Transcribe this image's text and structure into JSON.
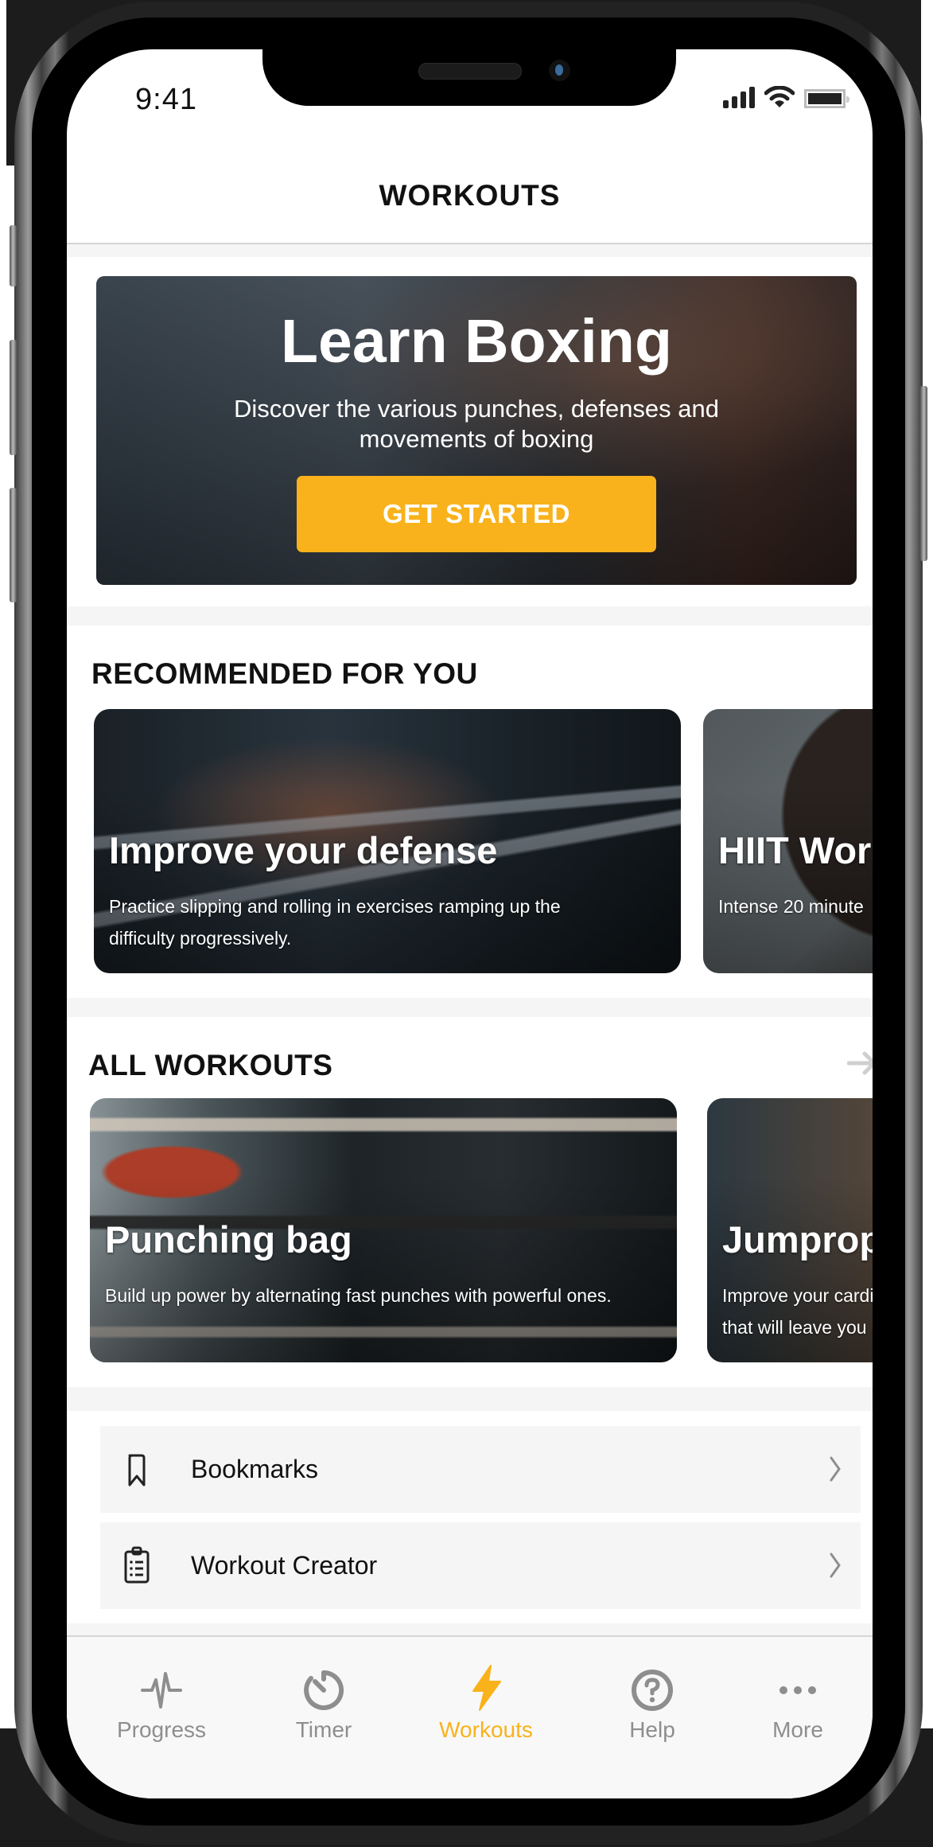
{
  "status_bar": {
    "time": "9:41",
    "icons": [
      "cellular-signal-icon",
      "wifi-icon",
      "battery-icon"
    ]
  },
  "header": {
    "title": "WORKOUTS"
  },
  "hero": {
    "title": "Learn Boxing",
    "subtitle": "Discover the various punches, defenses and movements of boxing",
    "button_label": "GET STARTED",
    "button_color": "#f9b21b"
  },
  "recommended": {
    "title": "RECOMMENDED FOR YOU",
    "cards": [
      {
        "title": "Improve your defense",
        "description": "Practice slipping and rolling in exercises ramping up the difficulty progressively."
      },
      {
        "title": "HIIT Wor",
        "description": "Intense 20 minute"
      }
    ]
  },
  "all_workouts": {
    "title": "ALL WORKOUTS",
    "see_all_icon": "arrow-right-icon",
    "cards": [
      {
        "title": "Punching bag",
        "description": "Build up power by alternating fast punches with powerful ones."
      },
      {
        "title": "Jumprop",
        "description": "Improve your cardi that will leave you"
      }
    ]
  },
  "links": [
    {
      "label": "Bookmarks",
      "icon": "bookmark-icon"
    },
    {
      "label": "Workout Creator",
      "icon": "clipboard-list-icon"
    }
  ],
  "tabbar": {
    "active_color": "#f9b21b",
    "inactive_color": "#8e8e8e",
    "tabs": [
      {
        "label": "Progress",
        "icon": "heartbeat-icon",
        "active": false
      },
      {
        "label": "Timer",
        "icon": "stopwatch-icon",
        "active": false
      },
      {
        "label": "Workouts",
        "icon": "lightning-bolt-icon",
        "active": true
      },
      {
        "label": "Help",
        "icon": "question-circle-icon",
        "active": false
      },
      {
        "label": "More",
        "icon": "more-dots-icon",
        "active": false
      }
    ]
  }
}
